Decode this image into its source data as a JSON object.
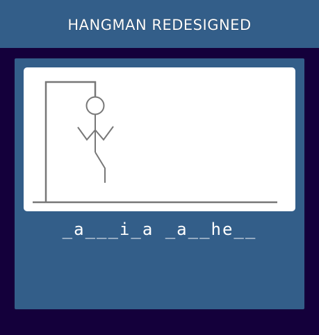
{
  "header": {
    "title": "HANGMAN REDESIGNED"
  },
  "game": {
    "word_display": "_a___i_a _a__he__",
    "colors": {
      "background": "#14003b",
      "header": "#335e89",
      "panel": "#335e89",
      "board": "#ffffff",
      "drawing": "#777777",
      "word_text": "#ffffff"
    },
    "drawing_parts": [
      "base",
      "pole",
      "beam",
      "rope",
      "head",
      "body",
      "left-arm",
      "right-arm",
      "left-leg"
    ]
  }
}
